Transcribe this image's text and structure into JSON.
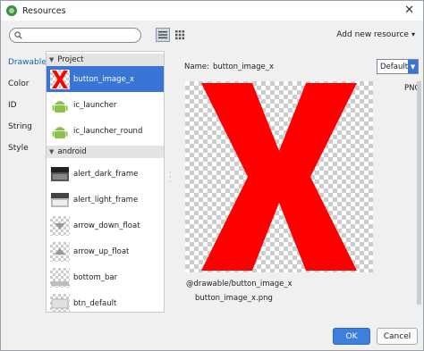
{
  "window": {
    "title": "Resources",
    "close_glyph": "✕"
  },
  "toolbar": {
    "search_placeholder": "",
    "add_resource_label": "Add new resource",
    "add_resource_glyph": "▾"
  },
  "types": [
    "Drawable",
    "Color",
    "ID",
    "String",
    "Style"
  ],
  "groups": [
    {
      "label": "Project",
      "items": [
        "button_image_x",
        "ic_launcher",
        "ic_launcher_round"
      ]
    },
    {
      "label": "android",
      "items": [
        "alert_dark_frame",
        "alert_light_frame",
        "arrow_down_float",
        "arrow_up_float",
        "bottom_bar",
        "btn_default"
      ]
    }
  ],
  "detail": {
    "name_label": "Name:",
    "name_value": "button_image_x",
    "config_value": "Default",
    "format_label": "PNG",
    "resource_path": "@drawable/button_image_x",
    "file_glyph": "",
    "file_name": "button_image_x.png"
  },
  "footer": {
    "ok_label": "OK",
    "cancel_label": "Cancel"
  },
  "colors": {
    "accent": "#3875d7",
    "preview_red": "#ff0000",
    "android_green": "#8bc34a"
  },
  "icons": {
    "app": "android-studio-icon",
    "search": "search-icon",
    "list_view": "list-view-icon",
    "grid_view": "grid-view-icon",
    "expand": "triangle-down-icon",
    "dropdown": "chevron-down-icon",
    "file": "file-icon"
  }
}
